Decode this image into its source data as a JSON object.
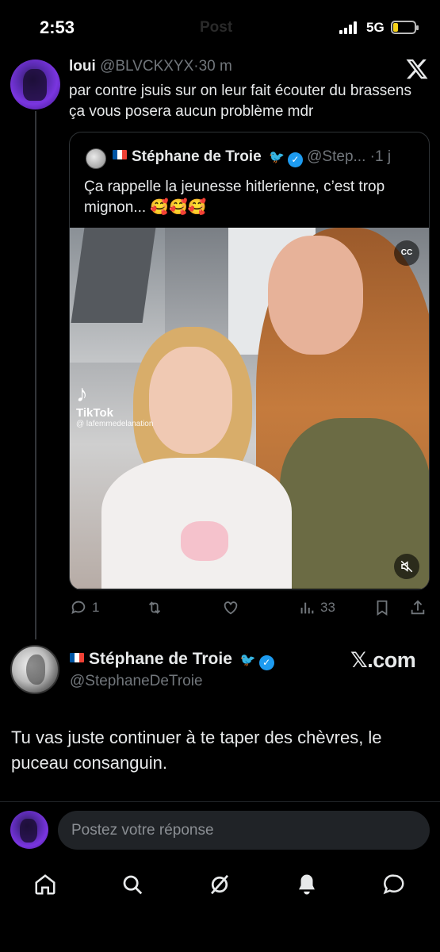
{
  "status_bar": {
    "time": "2:53",
    "ghost_title": "Post",
    "network": "5G",
    "battery_color": "#f5d21b"
  },
  "tweet": {
    "author_name": "loui",
    "author_handle": "@BLVCKXYX",
    "separator": "·",
    "time": "30 m",
    "text": "par contre jsuis sur on leur fait écouter du brassens ça vous posera aucun problème mdr",
    "x_icon": "x-logo-icon"
  },
  "quote": {
    "author_name": "Stéphane de Troie",
    "author_handle": "@Step...",
    "separator": "·",
    "time": "1 j",
    "text": "Ça rappelle la jeunesse hitlerienne, c’est trop mignon... 🥰🥰🥰",
    "video": {
      "watermark": "TikTok",
      "watermark_user": "@ lafemmedelanation",
      "cc_label": "CC"
    }
  },
  "actions": {
    "reply_count": "1",
    "retweet_count": "",
    "like_count": "",
    "views_count": "33"
  },
  "embed": {
    "author_name": "Stéphane de Troie",
    "author_handle": "@StephaneDeTroie",
    "brand": "𝕏.com",
    "text": "Tu vas juste continuer à te taper des chèvres, le puceau consanguin."
  },
  "reply": {
    "placeholder": "Postez votre réponse"
  },
  "nav": [
    "home-icon",
    "search-icon",
    "grok-icon",
    "notifications-icon",
    "messages-icon"
  ],
  "colors": {
    "background": "#000000",
    "text": "#e7e9ea",
    "muted": "#71767b",
    "verified": "#1d9bf0"
  }
}
